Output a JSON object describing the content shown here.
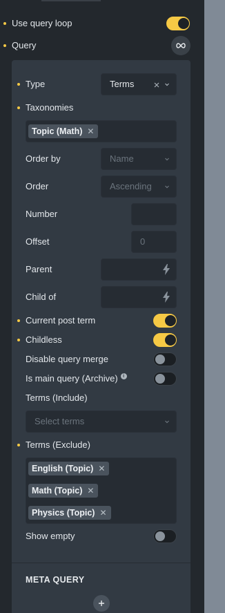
{
  "colors": {
    "accent": "#f6c945",
    "panel": "#23282d",
    "popup": "#323a43",
    "input": "#262c33",
    "chip": "#4a535d"
  },
  "top": {
    "use_query_loop": {
      "label": "Use query loop",
      "enabled": true
    },
    "query": {
      "label": "Query",
      "icon": "infinity-icon"
    }
  },
  "query_popup": {
    "type": {
      "label": "Type",
      "value": "Terms"
    },
    "taxonomies": {
      "label": "Taxonomies",
      "chips": [
        "Topic (Math)"
      ]
    },
    "order_by": {
      "label": "Order by",
      "placeholder": "Name"
    },
    "order": {
      "label": "Order",
      "placeholder": "Ascending"
    },
    "number": {
      "label": "Number",
      "value": ""
    },
    "offset": {
      "label": "Offset",
      "placeholder": "0"
    },
    "parent": {
      "label": "Parent",
      "value": ""
    },
    "child_of": {
      "label": "Child of",
      "value": ""
    },
    "current_post_term": {
      "label": "Current post term",
      "enabled": true
    },
    "childless": {
      "label": "Childless",
      "enabled": true
    },
    "disable_query_merge": {
      "label": "Disable query merge",
      "enabled": false
    },
    "is_main_query": {
      "label": "Is main query (Archive)",
      "enabled": false,
      "info_icon": "info-icon"
    },
    "terms_include": {
      "label": "Terms (Include)",
      "placeholder": "Select terms"
    },
    "terms_exclude": {
      "label": "Terms (Exclude)",
      "chips": [
        "English (Topic)",
        "Math (Topic)",
        "Physics (Topic)"
      ]
    },
    "show_empty": {
      "label": "Show empty",
      "enabled": false
    },
    "meta_query": {
      "title": "META QUERY",
      "add_icon": "plus-icon"
    }
  }
}
